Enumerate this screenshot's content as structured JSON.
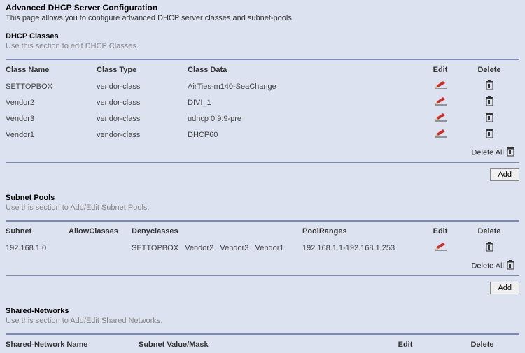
{
  "page": {
    "title": "Advanced DHCP Server Configuration",
    "subtitle": "This page allows you to configure advanced DHCP server classes and subnet-pools"
  },
  "buttons": {
    "add": "Add",
    "delete_all": "Delete All"
  },
  "classes": {
    "title": "DHCP Classes",
    "help": "Use this section to edit DHCP Classes.",
    "headers": {
      "name": "Class Name",
      "type": "Class Type",
      "data": "Class Data",
      "edit": "Edit",
      "delete": "Delete"
    },
    "rows": [
      {
        "name": "SETTOPBOX",
        "type": "vendor-class",
        "data": "AirTies-m140-SeaChange"
      },
      {
        "name": "Vendor2",
        "type": "vendor-class",
        "data": "DIVI_1"
      },
      {
        "name": "Vendor3",
        "type": "vendor-class",
        "data": "udhcp 0.9.9-pre"
      },
      {
        "name": "Vendor1",
        "type": "vendor-class",
        "data": "DHCP60"
      }
    ]
  },
  "subnet_pools": {
    "title": "Subnet Pools",
    "help": "Use this section to Add/Edit Subnet Pools.",
    "headers": {
      "subnet": "Subnet",
      "allow": "AllowClasses",
      "deny": "Denyclasses",
      "ranges": "PoolRanges",
      "edit": "Edit",
      "delete": "Delete"
    },
    "rows": [
      {
        "subnet": "192.168.1.0",
        "allow": "",
        "deny": "SETTOPBOX   Vendor2   Vendor3   Vendor1",
        "ranges": "192.168.1.1-192.168.1.253"
      }
    ]
  },
  "shared_networks": {
    "title": "Shared-Networks",
    "help": "Use this section to Add/Edit Shared Networks.",
    "headers": {
      "name": "Shared-Network Name",
      "subnet": "Subnet Value/Mask",
      "edit": "Edit",
      "delete": "Delete"
    }
  }
}
